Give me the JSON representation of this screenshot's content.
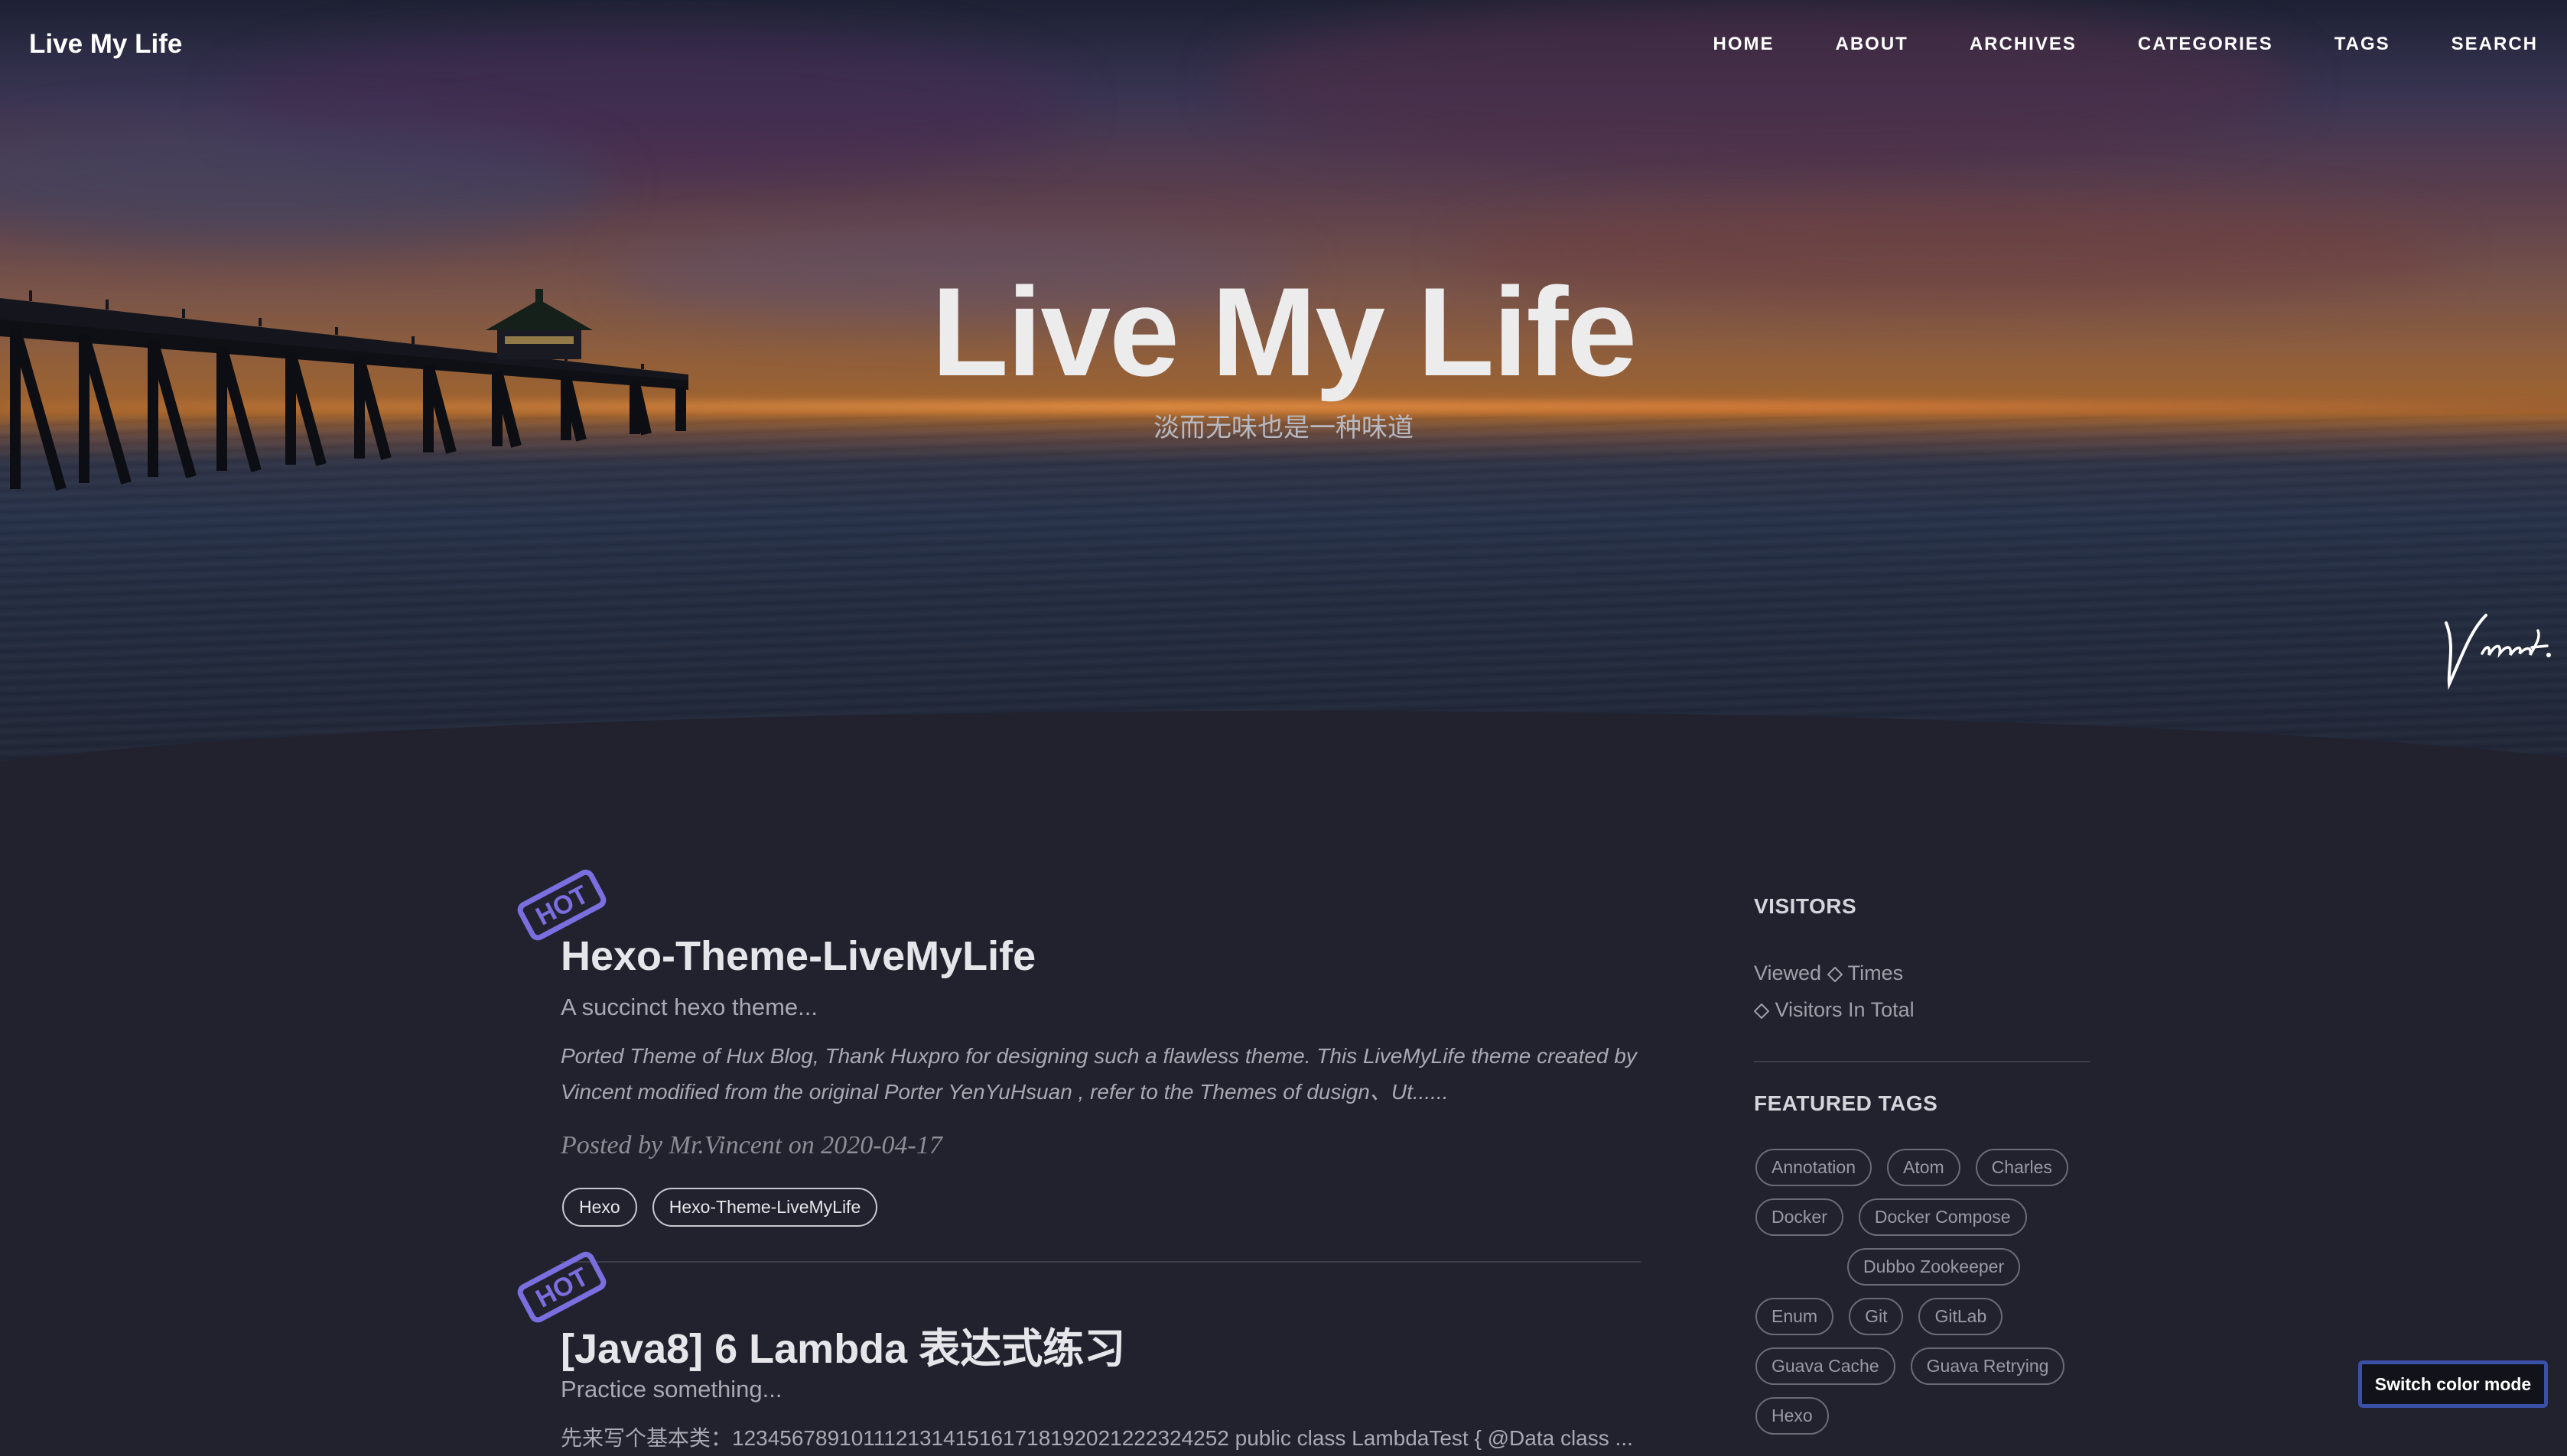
{
  "header": {
    "brand": "Live My Life",
    "nav": [
      "HOME",
      "ABOUT",
      "ARCHIVES",
      "CATEGORIES",
      "TAGS",
      "SEARCH"
    ]
  },
  "hero": {
    "title": "Live My Life",
    "subtitle": "淡而无味也是一种味道",
    "signature": "Vincent."
  },
  "posts": [
    {
      "badge": "HOT",
      "title": "Hexo-Theme-LiveMyLife",
      "subtitle": "A succinct hexo theme...",
      "excerpt": "Ported Theme of Hux Blog, Thank Huxpro for designing such a flawless theme. This LiveMyLife theme created by Vincent modified from the original Porter YenYuHsuan , refer to the Themes of dusign、Ut......",
      "meta": "Posted by Mr.Vincent on 2020-04-17",
      "tags": [
        "Hexo",
        "Hexo-Theme-LiveMyLife"
      ]
    },
    {
      "badge": "HOT",
      "title": "[Java8] 6 Lambda 表达式练习",
      "subtitle": "Practice something...",
      "excerpt": "先来写个基本类：123456789101112131415161718192021222324252 public class LambdaTest { @Data class ..."
    }
  ],
  "sidebar": {
    "visitors_heading": "VISITORS",
    "viewed_prefix": "Viewed",
    "viewed_suffix": "Times",
    "visitors_suffix": "Visitors In Total",
    "featured_heading": "FEATURED TAGS",
    "featured_tags": [
      "Annotation",
      "Atom",
      "Charles",
      "Docker",
      "Docker Compose",
      "Dubbo Zookeeper",
      "Enum",
      "Git",
      "GitLab",
      "Guava Cache",
      "Guava Retrying",
      "Hexo"
    ]
  },
  "switch_button": "Switch color mode",
  "colors": {
    "background": "#22222f",
    "badge": "#7b6fe0",
    "switch_border": "#3a4fa8"
  }
}
